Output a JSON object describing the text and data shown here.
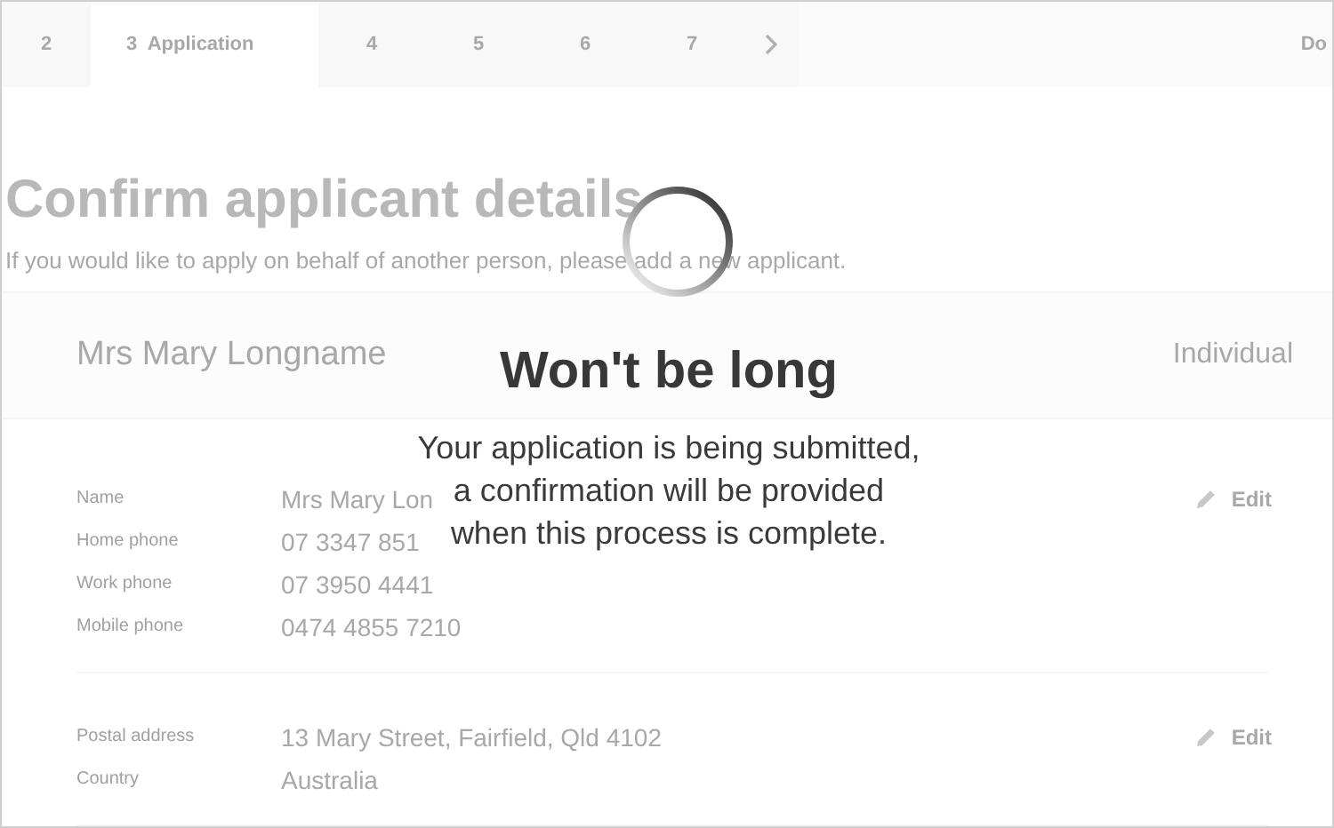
{
  "steps": [
    {
      "number": "2",
      "selected": false
    },
    {
      "number": "3",
      "label": "Application",
      "selected": true
    },
    {
      "number": "4",
      "selected": false
    },
    {
      "number": "5",
      "selected": false
    },
    {
      "number": "6",
      "selected": false
    },
    {
      "number": "7",
      "selected": false
    }
  ],
  "trailing_step": "Do",
  "heading": "Confirm applicant details",
  "intro": "If you would like to apply on behalf of another person, please add a new applicant.",
  "applicant": {
    "name": "Mrs Mary Longname",
    "type": "Individual"
  },
  "sections": [
    {
      "edit": "Edit",
      "rows": [
        {
          "label": "Name",
          "value": "Mrs Mary Lon"
        },
        {
          "label": "Home phone",
          "value": "07 3347 851"
        },
        {
          "label": "Work phone",
          "value": "07 3950 4441"
        },
        {
          "label": "Mobile phone",
          "value": "0474 4855 7210"
        }
      ]
    },
    {
      "edit": "Edit",
      "rows": [
        {
          "label": "Postal address",
          "value": "13 Mary Street, Fairfield, Qld 4102"
        },
        {
          "label": "Country",
          "value": "Australia"
        }
      ]
    }
  ],
  "loading": {
    "title": "Won't be long",
    "message_lines": [
      "Your application is being submitted,",
      "a confirmation will be provided",
      "when this process is complete."
    ]
  }
}
